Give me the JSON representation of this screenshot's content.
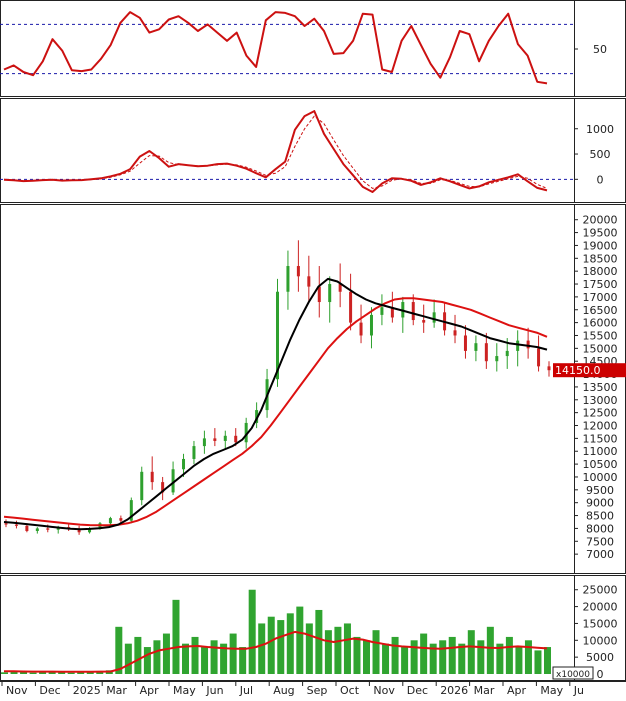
{
  "colors": {
    "up": "#2ea02e",
    "down": "#cc2222",
    "ma_fast": "#000000",
    "ma_slow": "#dd1111",
    "oscillator": "#cc1111",
    "guide": "#1a1aaa",
    "frame": "#222222",
    "label_bg": "#cc0000",
    "volume": "#1a9a1a"
  },
  "chart_data": [
    {
      "type": "line",
      "panel": "oscillator",
      "yticks": [
        50
      ],
      "ylim": [
        0,
        100
      ],
      "guides": [
        80,
        20
      ],
      "values": [
        25,
        30,
        22,
        18,
        35,
        62,
        48,
        24,
        23,
        25,
        38,
        55,
        82,
        95,
        88,
        70,
        74,
        86,
        90,
        82,
        72,
        80,
        70,
        60,
        70,
        42,
        28,
        85,
        95,
        94,
        90,
        78,
        87,
        72,
        44,
        45,
        60,
        93,
        92,
        25,
        22,
        60,
        78,
        55,
        32,
        15,
        40,
        72,
        68,
        35,
        60,
        78,
        93,
        56,
        42,
        10,
        8
      ]
    },
    {
      "type": "line",
      "panel": "momentum",
      "yticks": [
        1000,
        500,
        0
      ],
      "ylim": [
        -330,
        1450
      ],
      "guides": [
        0
      ],
      "series": [
        {
          "values": [
            -10,
            -20,
            -35,
            -30,
            -15,
            -10,
            -25,
            -20,
            -15,
            0,
            20,
            60,
            110,
            200,
            450,
            560,
            420,
            250,
            300,
            280,
            260,
            270,
            300,
            310,
            270,
            210,
            120,
            40,
            200,
            350,
            980,
            1250,
            1350,
            900,
            600,
            300,
            80,
            -150,
            -250,
            -80,
            20,
            10,
            -30,
            -110,
            -60,
            20,
            -40,
            -110,
            -180,
            -140,
            -60,
            -10,
            40,
            100,
            -40,
            -170,
            -220
          ]
        },
        {
          "values": [
            0,
            -10,
            -25,
            -25,
            -20,
            -12,
            -18,
            -20,
            -16,
            -5,
            10,
            40,
            90,
            160,
            320,
            470,
            460,
            330,
            290,
            280,
            265,
            265,
            285,
            300,
            285,
            240,
            165,
            80,
            120,
            250,
            650,
            1000,
            1250,
            1100,
            780,
            470,
            220,
            -30,
            -180,
            -130,
            -20,
            10,
            -10,
            -80,
            -80,
            -10,
            -20,
            -80,
            -140,
            -150,
            -90,
            -40,
            10,
            60,
            20,
            -100,
            -180
          ]
        }
      ]
    },
    {
      "type": "candlestick",
      "panel": "price",
      "ylim": [
        6500,
        20300
      ],
      "yticks": [
        20000,
        19500,
        19000,
        18500,
        18000,
        17500,
        17000,
        16500,
        16000,
        15500,
        15000,
        14500,
        14000,
        13500,
        13000,
        12500,
        12000,
        11500,
        11000,
        10500,
        10000,
        9500,
        9000,
        8500,
        8000,
        7500,
        7000
      ],
      "last_price_label": "14150.0",
      "ohlc": [
        [
          8200,
          8350,
          8050,
          8150
        ],
        [
          8150,
          8300,
          8000,
          8100
        ],
        [
          8100,
          8200,
          7850,
          7900
        ],
        [
          7900,
          8050,
          7800,
          8000
        ],
        [
          8000,
          8150,
          7850,
          7950
        ],
        [
          7950,
          8100,
          7800,
          8050
        ],
        [
          8050,
          8200,
          7900,
          8000
        ],
        [
          8000,
          8100,
          7750,
          7850
        ],
        [
          7850,
          8050,
          7800,
          8000
        ],
        [
          8000,
          8250,
          7950,
          8200
        ],
        [
          8200,
          8450,
          8100,
          8400
        ],
        [
          8400,
          8500,
          8150,
          8300
        ],
        [
          8300,
          9200,
          8200,
          9100
        ],
        [
          9100,
          10400,
          8900,
          10200
        ],
        [
          10200,
          10800,
          9500,
          9800
        ],
        [
          9800,
          10000,
          9100,
          9400
        ],
        [
          9400,
          10600,
          9300,
          10300
        ],
        [
          10300,
          10900,
          10000,
          10700
        ],
        [
          10700,
          11400,
          10500,
          11200
        ],
        [
          11200,
          11800,
          10900,
          11500
        ],
        [
          11500,
          11900,
          11200,
          11400
        ],
        [
          11400,
          11800,
          11100,
          11600
        ],
        [
          11600,
          11900,
          11200,
          11350
        ],
        [
          11350,
          12300,
          11100,
          12100
        ],
        [
          12100,
          12900,
          11900,
          12600
        ],
        [
          12600,
          14200,
          12300,
          13800
        ],
        [
          13800,
          17700,
          13500,
          17200
        ],
        [
          17200,
          18800,
          16500,
          18200
        ],
        [
          18200,
          19200,
          17200,
          17800
        ],
        [
          17800,
          18600,
          16800,
          17400
        ],
        [
          17400,
          18200,
          16200,
          16800
        ],
        [
          16800,
          17800,
          16000,
          17500
        ],
        [
          17500,
          18300,
          16600,
          17200
        ],
        [
          17200,
          17900,
          15700,
          16000
        ],
        [
          16000,
          16700,
          15200,
          15500
        ],
        [
          15500,
          16600,
          15000,
          16300
        ],
        [
          16300,
          17100,
          15900,
          16600
        ],
        [
          16600,
          17200,
          16000,
          16200
        ],
        [
          16200,
          17000,
          15600,
          16800
        ],
        [
          16800,
          17100,
          15900,
          16100
        ],
        [
          16100,
          16700,
          15600,
          16000
        ],
        [
          16000,
          16900,
          15800,
          16400
        ],
        [
          16400,
          16800,
          15500,
          15700
        ],
        [
          15700,
          16300,
          15200,
          15500
        ],
        [
          15500,
          15900,
          14600,
          14900
        ],
        [
          14900,
          15500,
          14500,
          15200
        ],
        [
          15200,
          15600,
          14200,
          14500
        ],
        [
          14500,
          15200,
          14100,
          14700
        ],
        [
          14700,
          15400,
          14200,
          14900
        ],
        [
          14900,
          15700,
          14300,
          15300
        ],
        [
          15300,
          15800,
          14600,
          15000
        ],
        [
          15000,
          15500,
          14100,
          14300
        ],
        [
          14300,
          14500,
          13900,
          14150
        ]
      ],
      "series": [
        {
          "values": [
            8250,
            8220,
            8180,
            8140,
            8100,
            8060,
            8020,
            7990,
            7970,
            7980,
            8010,
            8050,
            8150,
            8350,
            8650,
            8950,
            9250,
            9550,
            9850,
            10150,
            10450,
            10700,
            10900,
            11050,
            11200,
            11450,
            11900,
            12600,
            13500,
            14400,
            15300,
            16100,
            16800,
            17400,
            17700,
            17600,
            17350,
            17100,
            16900,
            16750,
            16650,
            16550,
            16450,
            16350,
            16250,
            16150,
            16050,
            15950,
            15850,
            15700,
            15550,
            15400,
            15300,
            15200,
            15150,
            15100,
            15050,
            14950
          ]
        },
        {
          "values": [
            8450,
            8420,
            8380,
            8340,
            8300,
            8260,
            8220,
            8180,
            8150,
            8130,
            8120,
            8120,
            8140,
            8200,
            8300,
            8450,
            8650,
            8900,
            9150,
            9400,
            9650,
            9900,
            10150,
            10400,
            10650,
            10900,
            11200,
            11550,
            12000,
            12500,
            13000,
            13500,
            14000,
            14500,
            15000,
            15400,
            15750,
            16050,
            16300,
            16550,
            16750,
            16900,
            16950,
            16950,
            16900,
            16850,
            16800,
            16700,
            16600,
            16500,
            16350,
            16200,
            16050,
            15900,
            15800,
            15700,
            15600,
            15450
          ]
        }
      ]
    },
    {
      "type": "bar",
      "panel": "volume",
      "unit_label": "x10000",
      "ylim": [
        0,
        27000
      ],
      "yticks": [
        25000,
        20000,
        15000,
        10000,
        5000,
        0
      ],
      "values": [
        500,
        700,
        600,
        400,
        800,
        600,
        500,
        400,
        700,
        600,
        900,
        1100,
        14000,
        9000,
        11000,
        8000,
        10000,
        12000,
        22000,
        9000,
        11000,
        8000,
        10000,
        9000,
        12000,
        8000,
        25000,
        15000,
        17000,
        16000,
        18000,
        20000,
        15000,
        19000,
        13000,
        14000,
        15000,
        11000,
        10000,
        13000,
        9000,
        11000,
        8000,
        10000,
        12000,
        9000,
        10000,
        11000,
        9000,
        13000,
        10000,
        14000,
        9000,
        11000,
        8000,
        10000,
        7000,
        8000
      ],
      "series": [
        {
          "values": [
            800,
            800,
            750,
            700,
            700,
            700,
            650,
            650,
            650,
            650,
            700,
            750,
            1500,
            3000,
            4500,
            6000,
            7000,
            7500,
            8000,
            8200,
            8300,
            8000,
            7800,
            7600,
            7500,
            7500,
            8000,
            9000,
            10500,
            11500,
            12500,
            12000,
            11000,
            10000,
            9500,
            10000,
            10500,
            10200,
            9500,
            9000,
            8500,
            8200,
            8000,
            7800,
            7600,
            7500,
            7700,
            8000,
            8200,
            8000,
            7800,
            7700,
            8000,
            8200,
            8000,
            7800,
            7600
          ]
        }
      ]
    }
  ],
  "x_axis": {
    "labels": [
      "Nov",
      "Dec",
      "2025",
      "Mar",
      "Apr",
      "May",
      "Jun",
      "Jul",
      "Aug",
      "Sep",
      "Oct",
      "Nov",
      "Dec",
      "2026",
      "Mar",
      "Apr",
      "May",
      "Ju"
    ]
  }
}
